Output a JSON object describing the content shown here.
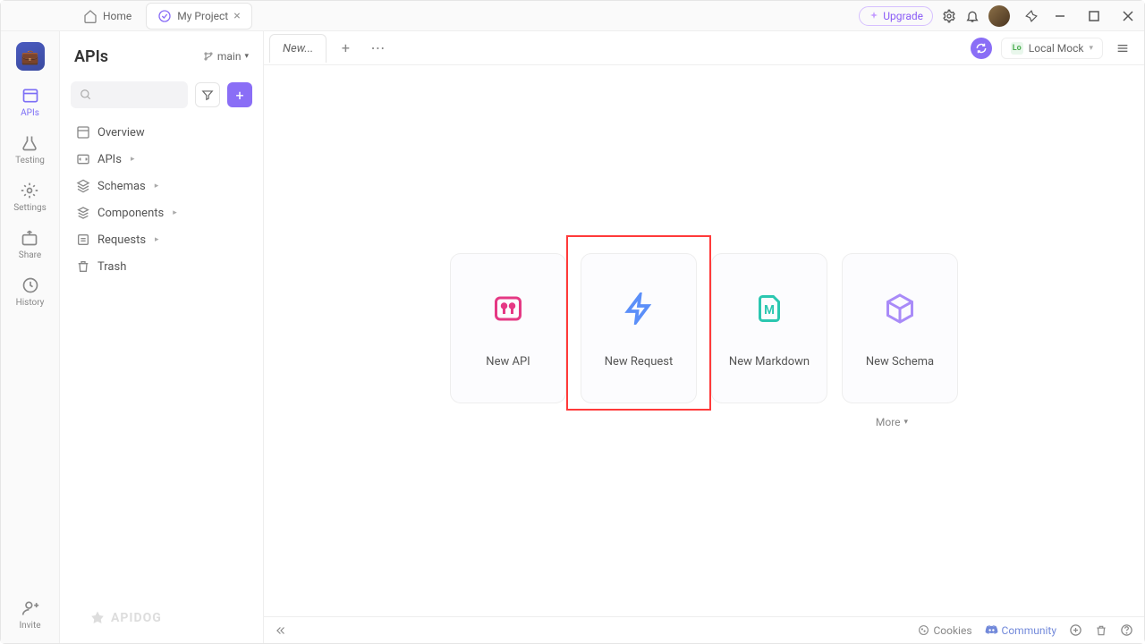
{
  "titlebar": {
    "home_label": "Home",
    "project_label": "My Project",
    "upgrade_label": "Upgrade"
  },
  "rail": {
    "items": [
      {
        "label": "APIs"
      },
      {
        "label": "Testing"
      },
      {
        "label": "Settings"
      },
      {
        "label": "Share"
      },
      {
        "label": "History"
      }
    ],
    "invite_label": "Invite"
  },
  "sidebar": {
    "title": "APIs",
    "branch": "main",
    "tree": [
      {
        "label": "Overview"
      },
      {
        "label": "APIs"
      },
      {
        "label": "Schemas"
      },
      {
        "label": "Components"
      },
      {
        "label": "Requests"
      },
      {
        "label": "Trash"
      }
    ]
  },
  "content": {
    "tab_label": "New...",
    "env_label": "Local Mock",
    "cards": [
      {
        "label": "New API"
      },
      {
        "label": "New Request"
      },
      {
        "label": "New Markdown"
      },
      {
        "label": "New Schema"
      }
    ],
    "more_label": "More"
  },
  "footer": {
    "cookies": "Cookies",
    "community": "Community"
  },
  "watermark": "APIDOG"
}
